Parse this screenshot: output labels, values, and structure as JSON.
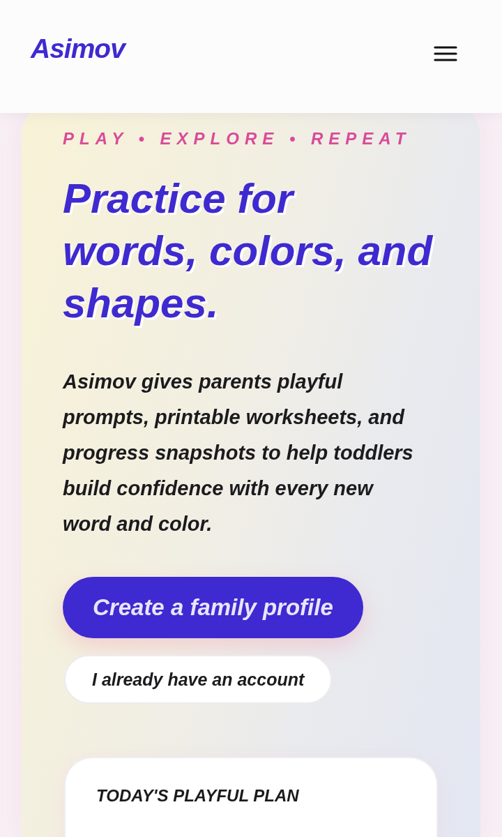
{
  "header": {
    "logo": "Asimov"
  },
  "hero": {
    "eyebrow": "PLAY • EXPLORE • REPEAT",
    "heading": "Practice for words, colors, and shapes.",
    "description": "Asimov gives parents playful prompts, printable worksheets, and progress snapshots to help toddlers build confidence with every new word and color.",
    "primary_button": "Create a family profile",
    "secondary_button": "I already have an account"
  },
  "plan_card": {
    "title": "TODAY'S PLAYFUL PLAN"
  }
}
